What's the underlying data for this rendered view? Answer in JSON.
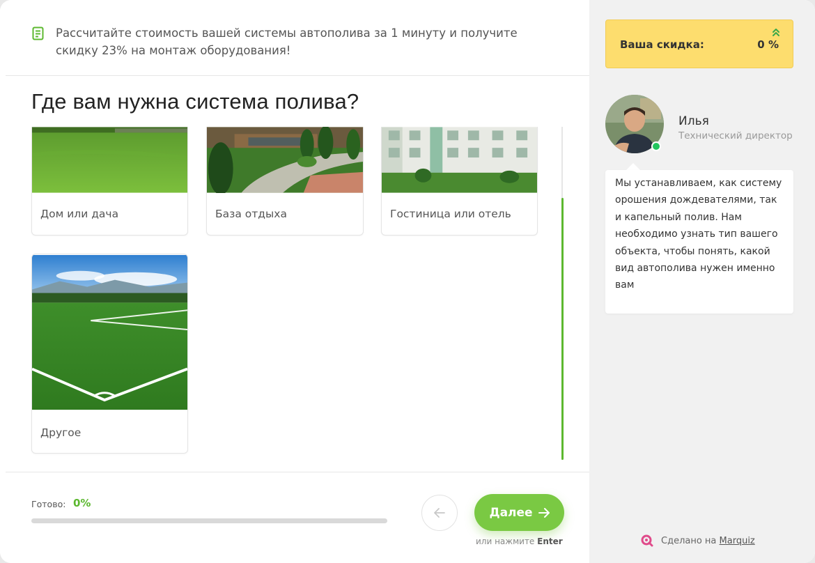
{
  "header": {
    "promo_text": "Рассчитайте стоимость вашей системы автополива за 1 минуту и получите скидку 23% на монтаж оборудования!",
    "promo_icon": "checklist-icon"
  },
  "question": {
    "title": "Где вам нужна система полива?"
  },
  "options": [
    {
      "label": "Дом или дача",
      "image": "lawn-photo"
    },
    {
      "label": "База отдыха",
      "image": "garden-path-photo"
    },
    {
      "label": "Гостиница или отель",
      "image": "hotel-photo"
    },
    {
      "label": "Другое",
      "image": "football-field-photo"
    }
  ],
  "footer": {
    "ready_label": "Готово:",
    "ready_value": "0%",
    "progress_fraction": 0,
    "next_label": "Далее",
    "hint_prefix": "или нажмите",
    "hint_key": "Enter"
  },
  "sidebar": {
    "discount_label": "Ваша скидка:",
    "discount_value": "0 %",
    "manager_name": "Илья",
    "manager_role": "Технический директор",
    "message": "Мы устанавливаем, как систему орошения дождевателями, так и капельный полив. Нам необходимо узнать тип вашего объекта, чтобы понять, какой вид автополива нужен именно вам",
    "made_prefix": "Сделано на",
    "made_link": "Marquiz"
  },
  "colors": {
    "accent_green": "#7ac943",
    "progress_green": "#5cb82f",
    "discount_yellow": "#fddd6e"
  }
}
